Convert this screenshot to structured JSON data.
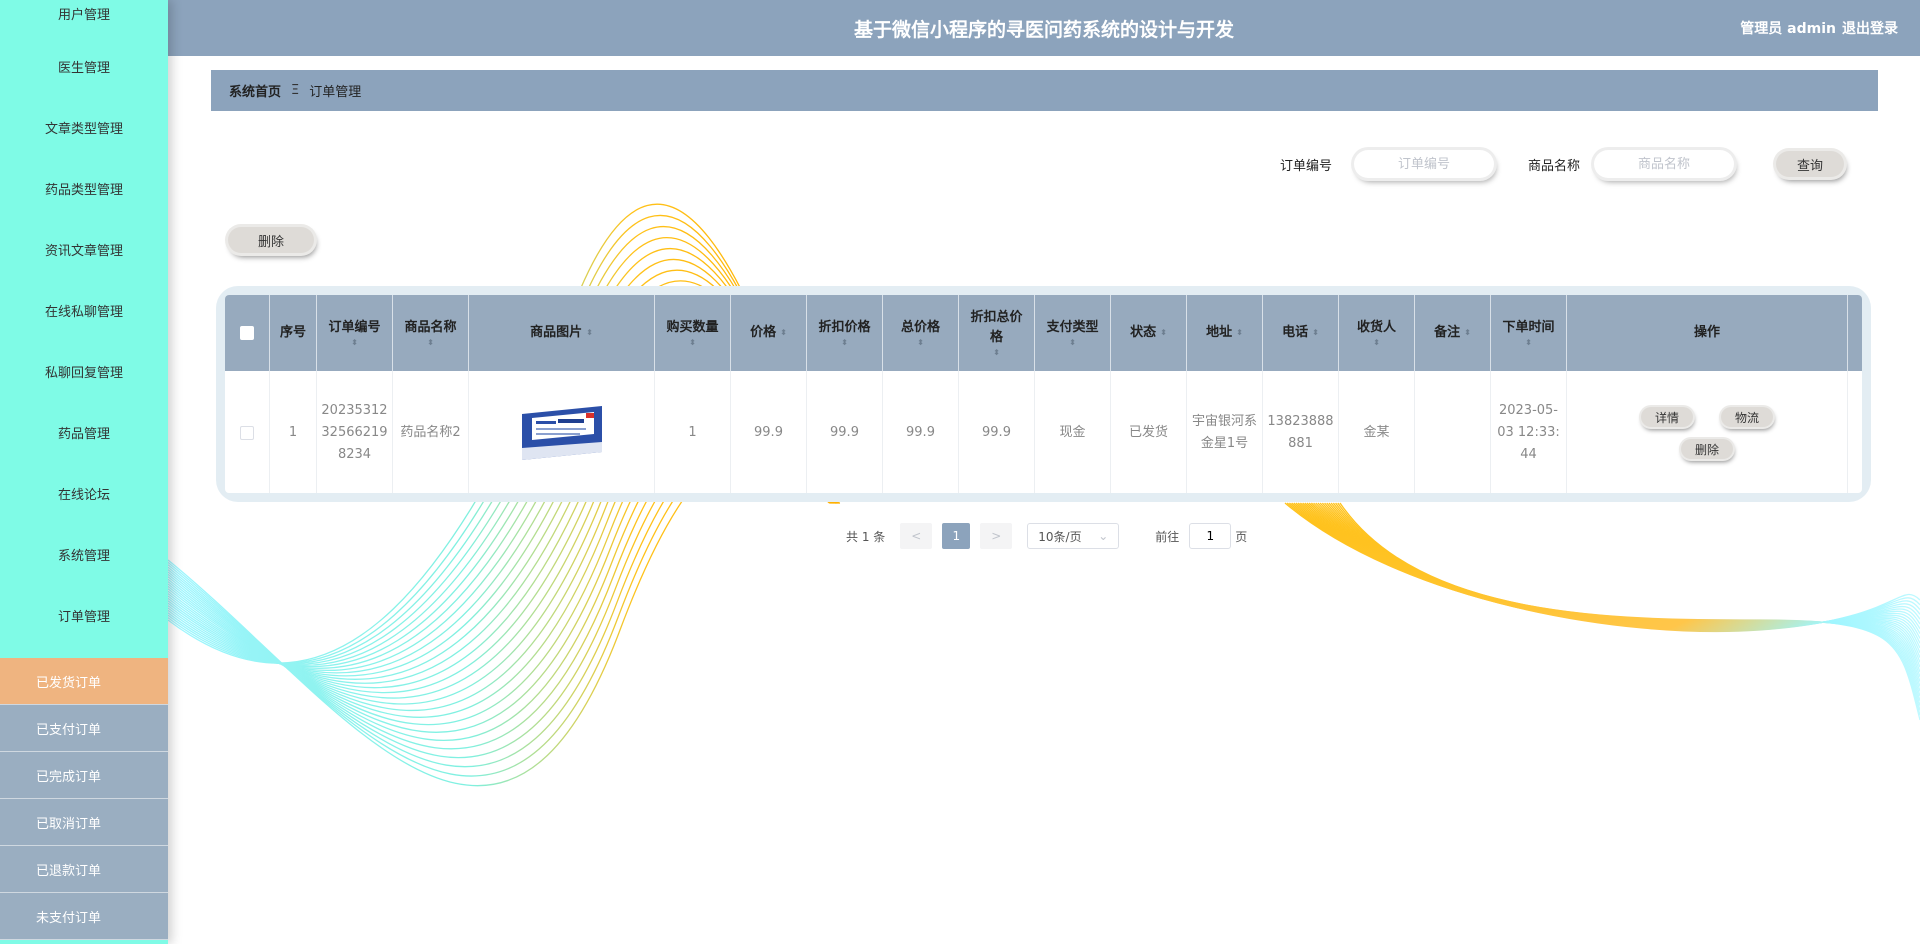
{
  "app": {
    "title": "基于微信小程序的寻医问药系统的设计与开发"
  },
  "header": {
    "user": "管理员 admin",
    "logout": "退出登录"
  },
  "sidebar": {
    "items": [
      {
        "label": "用户管理"
      },
      {
        "label": "医生管理"
      },
      {
        "label": "文章类型管理"
      },
      {
        "label": "药品类型管理"
      },
      {
        "label": "资讯文章管理"
      },
      {
        "label": "在线私聊管理"
      },
      {
        "label": "私聊回复管理"
      },
      {
        "label": "药品管理"
      },
      {
        "label": "在线论坛"
      },
      {
        "label": "系统管理"
      },
      {
        "label": "订单管理"
      }
    ],
    "sub_items": [
      {
        "label": "已发货订单"
      },
      {
        "label": "已支付订单"
      },
      {
        "label": "已完成订单"
      },
      {
        "label": "已取消订单"
      },
      {
        "label": "已退款订单"
      },
      {
        "label": "未支付订单"
      }
    ],
    "active_color": "#efb480"
  },
  "breadcrumb": {
    "home": "系统首页",
    "separator": "Ξ",
    "current": "订单管理"
  },
  "search": {
    "order_no_label": "订单编号",
    "order_no_placeholder": "订单编号",
    "product_label": "商品名称",
    "product_placeholder": "商品名称",
    "query_button": "查询"
  },
  "toolbar": {
    "delete_button": "删除"
  },
  "table": {
    "headers": [
      "序号",
      "订单编号",
      "商品名称",
      "商品图片",
      "购买数量",
      "价格",
      "折扣价格",
      "总价格",
      "折扣总价格",
      "支付类型",
      "状态",
      "地址",
      "电话",
      "收货人",
      "备注",
      "下单时间",
      "操作"
    ],
    "rows": [
      {
        "index": "1",
        "order_no": "20235312325662198234",
        "product": "药品名称2",
        "quantity": "1",
        "price": "99.9",
        "discount_price": "99.9",
        "total": "99.9",
        "discount_total": "99.9",
        "pay_type": "现金",
        "status": "已发货",
        "address": "宇宙银河系金星1号",
        "phone": "13823888881",
        "receiver": "金某",
        "note": "",
        "time": "2023-05-03 12:33:44",
        "actions": {
          "detail": "详情",
          "logistics": "物流",
          "delete": "删除"
        }
      }
    ]
  },
  "pagination": {
    "total": "共 1 条",
    "prev": "<",
    "page": "1",
    "next": ">",
    "page_size": "10条/页",
    "goto_label": "前往",
    "goto_value": "1",
    "page_suffix": "页"
  },
  "colors": {
    "header": "#8ca3bc",
    "sidebar": "#7ffbe6",
    "table_header": "#97aabe"
  }
}
